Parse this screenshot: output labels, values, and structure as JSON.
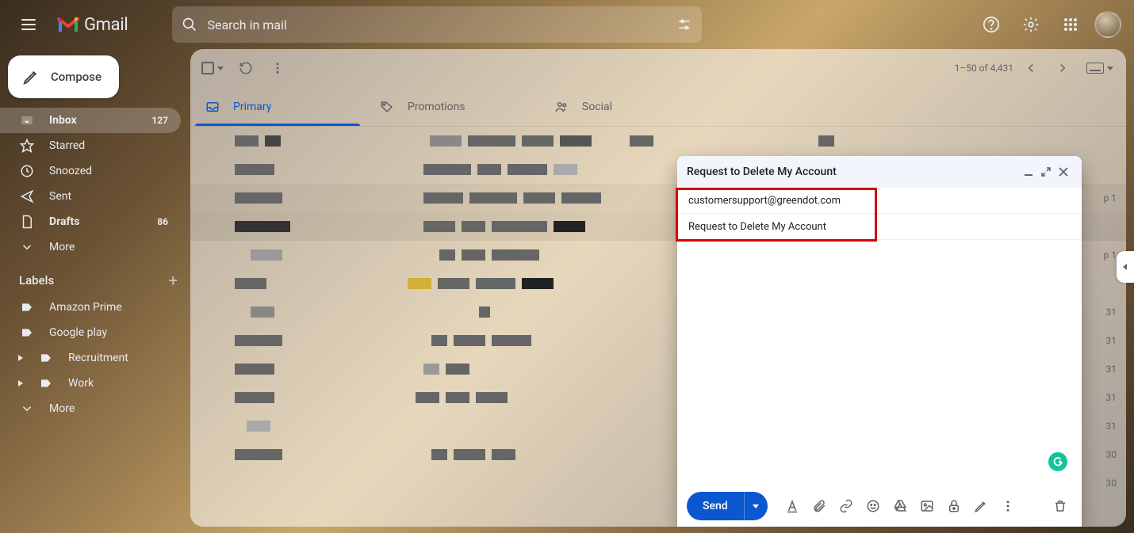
{
  "header": {
    "app_name": "Gmail",
    "search_placeholder": "Search in mail"
  },
  "sidebar": {
    "compose_label": "Compose",
    "items": [
      {
        "label": "Inbox",
        "count": "127"
      },
      {
        "label": "Starred",
        "count": ""
      },
      {
        "label": "Snoozed",
        "count": ""
      },
      {
        "label": "Sent",
        "count": ""
      },
      {
        "label": "Drafts",
        "count": "86"
      },
      {
        "label": "More",
        "count": ""
      }
    ],
    "labels_title": "Labels",
    "labels": [
      {
        "label": "Amazon Prime"
      },
      {
        "label": "Google play"
      },
      {
        "label": "Recruitment"
      },
      {
        "label": "Work"
      },
      {
        "label": "More"
      }
    ]
  },
  "toolbar": {
    "range_text": "1–50 of 4,431"
  },
  "tabs": {
    "primary": "Primary",
    "promotions": "Promotions",
    "social": "Social"
  },
  "list": {
    "dates": [
      "",
      "",
      "p 1",
      "",
      "p 1",
      "",
      "31",
      "31",
      "31",
      "31",
      "31",
      "30",
      "30"
    ]
  },
  "compose": {
    "title": "Request to Delete My Account",
    "to": "customersupport@greendot.com",
    "subject": "Request to Delete My Account",
    "body": "",
    "send_label": "Send"
  }
}
